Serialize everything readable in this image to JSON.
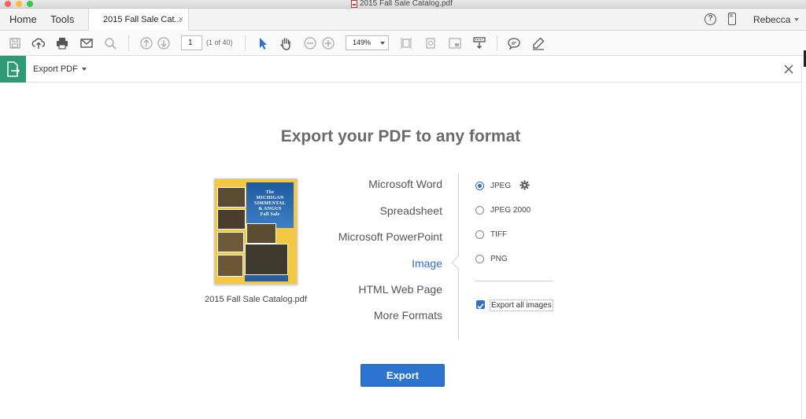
{
  "window": {
    "title": "2015 Fall Sale Catalog.pdf"
  },
  "nav": {
    "home": "Home",
    "tools": "Tools"
  },
  "doc_tab": {
    "label": "2015 Fall Sale Cat...",
    "close": "×"
  },
  "header": {
    "help": "?",
    "user": "Rebecca"
  },
  "toolbar": {
    "page_value": "1",
    "page_count": "(1 of 40)",
    "zoom": "149%"
  },
  "export_bar": {
    "label": "Export PDF"
  },
  "main": {
    "title": "Export your PDF to any format",
    "file_caption": "2015 Fall Sale Catalog.pdf",
    "thumbnail_title": [
      "The",
      "MICHIGAN",
      "SIMMENTAL",
      "& ANGUS",
      "Fall Sale"
    ],
    "formats": [
      "Microsoft Word",
      "Spreadsheet",
      "Microsoft PowerPoint",
      "Image",
      "HTML Web Page",
      "More Formats"
    ],
    "active_format": "Image",
    "image_options": [
      {
        "label": "JPEG",
        "selected": true
      },
      {
        "label": "JPEG 2000",
        "selected": false
      },
      {
        "label": "TIFF",
        "selected": false
      },
      {
        "label": "PNG",
        "selected": false
      }
    ],
    "export_all_images": {
      "label": "Export all images",
      "checked": true
    },
    "export_button": "Export"
  },
  "colors": {
    "accent": "#2d6ec8",
    "export_tool": "#2e9b76",
    "button": "#2d74d0"
  }
}
